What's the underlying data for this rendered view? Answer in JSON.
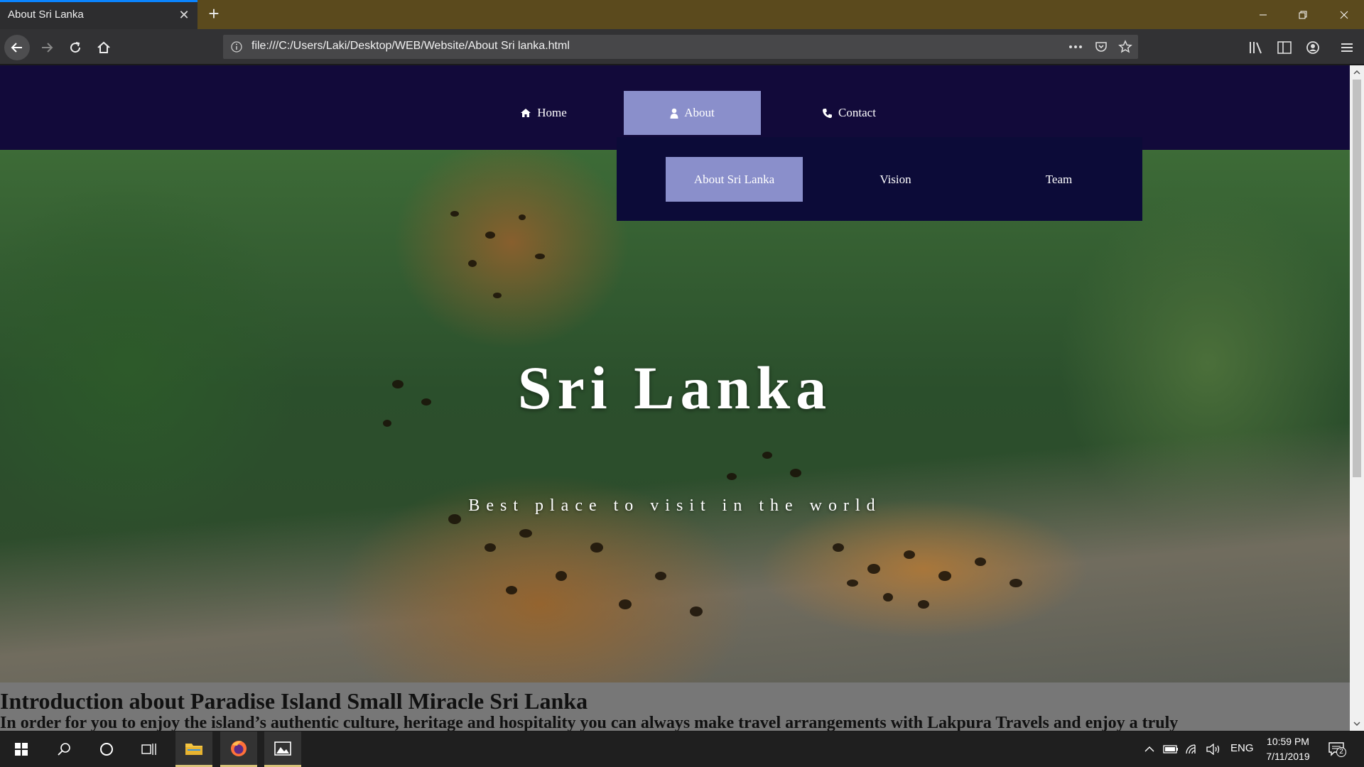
{
  "browser": {
    "tab_title": "About Sri Lanka",
    "url": "file:///C:/Users/Laki/Desktop/WEB/Website/About Sri lanka.html",
    "accent_color": "#0a84ff",
    "titlebar_color": "#5b4a1d"
  },
  "site": {
    "menu": {
      "home": "Home",
      "about": "About",
      "contact": "Contact"
    },
    "about_submenu": {
      "about_sri_lanka": "About Sri Lanka",
      "vision": "Vision",
      "team": "Team"
    },
    "hero": {
      "title": "Sri Lanka",
      "subtitle": "Best place to visit in the world"
    },
    "intro": {
      "heading": "Introduction about Paradise Island Small Miracle Sri Lanka",
      "text": "In order for you to enjoy the island’s authentic culture, heritage and hospitality you can always make travel arrangements with Lakpura Travels and enjoy a truly"
    },
    "colors": {
      "header_bg": "#120a3a",
      "dropdown_bg": "#0c0b38",
      "active_item": "#8a8fcb"
    }
  },
  "taskbar": {
    "language": "ENG",
    "time": "10:59 PM",
    "date": "7/11/2019",
    "notification_count": "2"
  }
}
